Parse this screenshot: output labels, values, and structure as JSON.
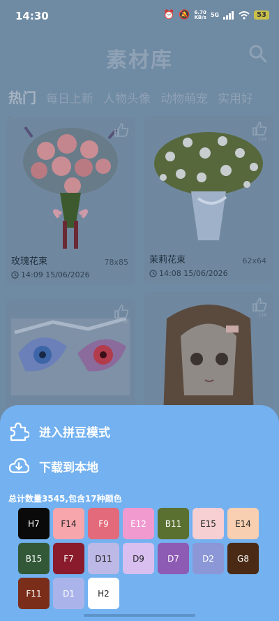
{
  "status_bar": {
    "time": "14:30",
    "net_speed_value": "6.70",
    "net_speed_unit": "KB/s",
    "network": "5G",
    "battery": "53",
    "icons": [
      "alarm-icon",
      "mute-icon",
      "signal-icon",
      "wifi-icon"
    ]
  },
  "header": {
    "title": "素材库",
    "search_icon": "search-icon"
  },
  "tabs": [
    {
      "label": "热门",
      "active": true
    },
    {
      "label": "每日上新",
      "active": false
    },
    {
      "label": "人物头像",
      "active": false
    },
    {
      "label": "动物萌宠",
      "active": false
    },
    {
      "label": "实用好",
      "active": false
    }
  ],
  "cards": [
    {
      "name": "玫瑰花束",
      "size": "78x85",
      "date": "14:09 15/06/2026",
      "likes": ""
    },
    {
      "name": "茉莉花束",
      "size": "62x64",
      "date": "14:08 15/06/2026",
      "likes": "164"
    },
    {
      "name": "",
      "size": "",
      "date": "",
      "likes": "86"
    },
    {
      "name": "",
      "size": "",
      "date": "",
      "likes": "116"
    }
  ],
  "sheet": {
    "puzzle_action": "进入拼豆模式",
    "download_action": "下载到本地",
    "summary": "总计数量3545,包含17种颜色",
    "swatches": [
      {
        "code": "H7",
        "color": "#0a0a0a",
        "text_color": "#ffffff"
      },
      {
        "code": "F14",
        "color": "#f7a6ab",
        "text_color": "#222222"
      },
      {
        "code": "F9",
        "color": "#e26a7a",
        "text_color": "#ffffff"
      },
      {
        "code": "E12",
        "color": "#f19ad0",
        "text_color": "#ffffff"
      },
      {
        "code": "B11",
        "color": "#5a7030",
        "text_color": "#ffffff"
      },
      {
        "code": "E15",
        "color": "#f5cfd2",
        "text_color": "#222222"
      },
      {
        "code": "E14",
        "color": "#f8cfb0",
        "text_color": "#222222"
      },
      {
        "code": "B15",
        "color": "#325838",
        "text_color": "#ffffff"
      },
      {
        "code": "F7",
        "color": "#8a1b2c",
        "text_color": "#ffffff"
      },
      {
        "code": "D11",
        "color": "#bdb9e6",
        "text_color": "#222222"
      },
      {
        "code": "D9",
        "color": "#d8bff0",
        "text_color": "#222222"
      },
      {
        "code": "D7",
        "color": "#8d5ab4",
        "text_color": "#ffffff"
      },
      {
        "code": "D2",
        "color": "#8b97d6",
        "text_color": "#ffffff"
      },
      {
        "code": "G8",
        "color": "#4a2a14",
        "text_color": "#ffffff"
      },
      {
        "code": "F11",
        "color": "#7a2e1a",
        "text_color": "#ffffff"
      },
      {
        "code": "D1",
        "color": "#aab4ea",
        "text_color": "#ffffff"
      },
      {
        "code": "H2",
        "color": "#ffffff",
        "text_color": "#222222"
      }
    ]
  }
}
